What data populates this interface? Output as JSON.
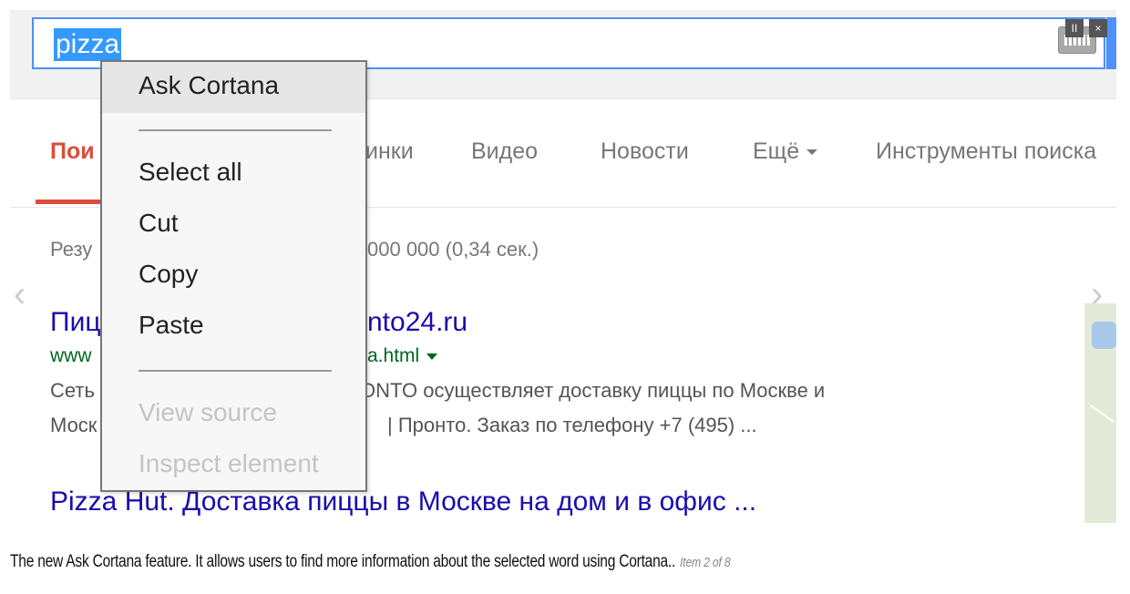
{
  "search": {
    "query": "pizza",
    "pause_label": "II",
    "close_label": "×"
  },
  "tabs": [
    {
      "label": "Пои"
    },
    {
      "label": "инки"
    },
    {
      "label": "Видео"
    },
    {
      "label": "Новости"
    },
    {
      "label": "Ещё"
    },
    {
      "label": "Инструменты поиска"
    }
  ],
  "stats": {
    "text_left": "Резу",
    "text_right": "000 000 (0,34 сек.)"
  },
  "results": [
    {
      "title_left": "Пиц",
      "title_right": "nto24.ru",
      "url_left": "www",
      "url_right": "a.html",
      "snippet_line1_left": "Сеть",
      "snippet_line1_right": "ONTO осуществляет доставку пиццы по Москве и",
      "snippet_line2_left": "Моск",
      "snippet_line2_right": "| Пронто. Заказ по телефону +7 (495) ..."
    },
    {
      "title": "Pizza Hut. Доставка пиццы в Москве на дом и в офис ..."
    }
  ],
  "nav": {
    "prev": "‹",
    "next": "›"
  },
  "context_menu": {
    "items": [
      {
        "label": "Ask Cortana",
        "highlighted": true,
        "disabled": false
      },
      {
        "label": "Select all",
        "disabled": false
      },
      {
        "label": "Cut",
        "disabled": false
      },
      {
        "label": "Copy",
        "disabled": false
      },
      {
        "label": "Paste",
        "disabled": false
      },
      {
        "label": "View source",
        "disabled": true
      },
      {
        "label": "Inspect element",
        "disabled": true
      }
    ]
  },
  "caption": {
    "text": "The new Ask Cortana feature. It allows users to find more information about the selected word using Cortana..",
    "counter": "Item 2 of 8"
  },
  "colors": {
    "selection": "#3399ff",
    "active_tab": "#dd4b39",
    "link": "#1a0dab",
    "url": "#006621",
    "search_border": "#4d90fe"
  }
}
